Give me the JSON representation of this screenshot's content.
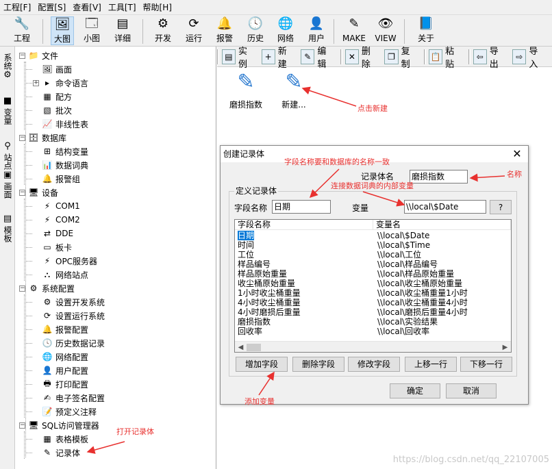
{
  "menu": [
    "工程[F]",
    "配置[S]",
    "查看[V]",
    "工具[T]",
    "帮助[H]"
  ],
  "toolbar": {
    "items": [
      {
        "label": "工程",
        "icon": "wrench-icon",
        "glyph": "🔧"
      },
      {
        "label": "大图",
        "icon": "large-icon-view-icon",
        "glyph": "🖼"
      },
      {
        "label": "小图",
        "icon": "small-icon-view-icon",
        "glyph": "🗔"
      },
      {
        "label": "详细",
        "icon": "detail-view-icon",
        "glyph": "▤"
      },
      {
        "label": "开发",
        "icon": "gear-icon",
        "glyph": "⚙"
      },
      {
        "label": "运行",
        "icon": "run-icon",
        "glyph": "⟳"
      },
      {
        "label": "报警",
        "icon": "alarm-bell-icon",
        "glyph": "🔔"
      },
      {
        "label": "历史",
        "icon": "history-clock-icon",
        "glyph": "🕓"
      },
      {
        "label": "网络",
        "icon": "network-globe-icon",
        "glyph": "🌐"
      },
      {
        "label": "用户",
        "icon": "user-icon",
        "glyph": "👤"
      },
      {
        "label": "MAKE",
        "icon": "make-edit-icon",
        "glyph": "✎"
      },
      {
        "label": "VIEW",
        "icon": "view-eye-icon",
        "glyph": "👁"
      },
      {
        "label": "关于",
        "icon": "about-book-icon",
        "glyph": "📘"
      }
    ]
  },
  "sidetabs": [
    "系统",
    "变量",
    "站点",
    "画面",
    "模板"
  ],
  "tree": [
    {
      "label": "文件",
      "icon": "folder-icon",
      "glyph": "📁",
      "level": 0,
      "exp": "−"
    },
    {
      "label": "画面",
      "icon": "picture-icon",
      "glyph": "🖼",
      "level": 1
    },
    {
      "label": "命令语言",
      "icon": "command-icon",
      "glyph": "▸",
      "level": 1,
      "exp": "+"
    },
    {
      "label": "配方",
      "icon": "recipe-icon",
      "glyph": "▦",
      "level": 1
    },
    {
      "label": "批次",
      "icon": "batch-icon",
      "glyph": "▧",
      "level": 1
    },
    {
      "label": "非线性表",
      "icon": "nonlinear-table-icon",
      "glyph": "📈",
      "level": 1
    },
    {
      "label": "数据库",
      "icon": "database-icon",
      "glyph": "🗄",
      "level": 0,
      "exp": "−"
    },
    {
      "label": "结构变量",
      "icon": "struct-variable-icon",
      "glyph": "⊞",
      "level": 1
    },
    {
      "label": "数据词典",
      "icon": "data-dictionary-icon",
      "glyph": "📊",
      "level": 1
    },
    {
      "label": "报警组",
      "icon": "alarm-group-icon",
      "glyph": "🔔",
      "level": 1
    },
    {
      "label": "设备",
      "icon": "device-icon",
      "glyph": "🖥",
      "level": 0,
      "exp": "−"
    },
    {
      "label": "COM1",
      "icon": "com-port-icon",
      "glyph": "⚡",
      "level": 1
    },
    {
      "label": "COM2",
      "icon": "com-port-icon",
      "glyph": "⚡",
      "level": 1
    },
    {
      "label": "DDE",
      "icon": "dde-icon",
      "glyph": "⇄",
      "level": 1
    },
    {
      "label": "板卡",
      "icon": "board-card-icon",
      "glyph": "▭",
      "level": 1
    },
    {
      "label": "OPC服务器",
      "icon": "opc-server-icon",
      "glyph": "⚡",
      "level": 1
    },
    {
      "label": "网络站点",
      "icon": "network-site-icon",
      "glyph": "⛬",
      "level": 1
    },
    {
      "label": "系统配置",
      "icon": "system-config-icon",
      "glyph": "⚙",
      "level": 0,
      "exp": "−"
    },
    {
      "label": "设置开发系统",
      "icon": "dev-system-icon",
      "glyph": "⚙",
      "level": 1
    },
    {
      "label": "设置运行系统",
      "icon": "run-system-icon",
      "glyph": "⟳",
      "level": 1
    },
    {
      "label": "报警配置",
      "icon": "alarm-config-icon",
      "glyph": "🔔",
      "level": 1
    },
    {
      "label": "历史数据记录",
      "icon": "history-record-icon",
      "glyph": "🕓",
      "level": 1
    },
    {
      "label": "网络配置",
      "icon": "network-config-icon",
      "glyph": "🌐",
      "level": 1
    },
    {
      "label": "用户配置",
      "icon": "user-config-icon",
      "glyph": "👤",
      "level": 1
    },
    {
      "label": "打印配置",
      "icon": "print-config-icon",
      "glyph": "🖶",
      "level": 1
    },
    {
      "label": "电子签名配置",
      "icon": "e-signature-icon",
      "glyph": "✍",
      "level": 1
    },
    {
      "label": "预定义注释",
      "icon": "predefined-note-icon",
      "glyph": "📝",
      "level": 1
    },
    {
      "label": "SQL访问管理器",
      "icon": "sql-manager-icon",
      "glyph": "🖥",
      "level": 0,
      "exp": "−"
    },
    {
      "label": "表格模板",
      "icon": "table-template-icon",
      "glyph": "▦",
      "level": 1
    },
    {
      "label": "记录体",
      "icon": "record-body-icon",
      "glyph": "✎",
      "level": 1
    }
  ],
  "rtool": [
    {
      "label": "实例",
      "icon": "instance-icon",
      "glyph": "▤"
    },
    {
      "label": "新建",
      "icon": "new-icon",
      "glyph": "+"
    },
    {
      "label": "编辑",
      "icon": "edit-icon",
      "glyph": "✎"
    },
    {
      "label": "删除",
      "icon": "delete-icon",
      "glyph": "✕"
    },
    {
      "label": "复制",
      "icon": "copy-icon",
      "glyph": "❐"
    },
    {
      "label": "粘贴",
      "icon": "paste-icon",
      "glyph": "📋"
    },
    {
      "label": "导出",
      "icon": "export-icon",
      "glyph": "⇦"
    },
    {
      "label": "导入",
      "icon": "import-icon",
      "glyph": "⇨"
    }
  ],
  "cards": [
    "磨损指数",
    "新建..."
  ],
  "dialog": {
    "title": "创建记录体",
    "close": "✕",
    "record_name_label": "记录体名",
    "record_name_value": "磨损指数",
    "group_label": "定义记录体",
    "field_name_label": "字段名称",
    "field_name_value": "日期",
    "variable_label": "变量",
    "variable_value": "\\\\local\\$Date",
    "browse_label": "?",
    "columns": [
      "字段名称",
      "变量名"
    ],
    "rows": [
      [
        "日期",
        "\\\\local\\$Date"
      ],
      [
        "时间",
        "\\\\local\\$Time"
      ],
      [
        "工位",
        "\\\\local\\工位"
      ],
      [
        "样品编号",
        "\\\\local\\样品编号"
      ],
      [
        "样品原始重量",
        "\\\\local\\样品原始重量"
      ],
      [
        "收尘桶原始重量",
        "\\\\local\\收尘桶原始重量"
      ],
      [
        "1小时收尘桶重量",
        "\\\\local\\收尘桶重量1小时"
      ],
      [
        "4小时收尘桶重量",
        "\\\\local\\收尘桶重量4小时"
      ],
      [
        "4小时磨损后重量",
        "\\\\local\\磨损后重量4小时"
      ],
      [
        "磨损指数",
        "\\\\local\\实验结果"
      ],
      [
        "回收率",
        "\\\\local\\回收率"
      ]
    ],
    "buttons": [
      "增加字段",
      "删除字段",
      "修改字段",
      "上移一行",
      "下移一行"
    ],
    "ok": "确定",
    "cancel": "取消"
  },
  "annotations": {
    "click_new": "点击新建",
    "field_same": "字段名称要和数据库的名称一致",
    "name": "名称",
    "link_var": "连接数据词典的内部变量",
    "add_var": "添加变量",
    "open_record": "打开记录体"
  },
  "watermark": "https://blog.csdn.net/qq_22107005",
  "colors": {
    "annotation": "#e8312f",
    "selection": "#cfe4f7"
  }
}
